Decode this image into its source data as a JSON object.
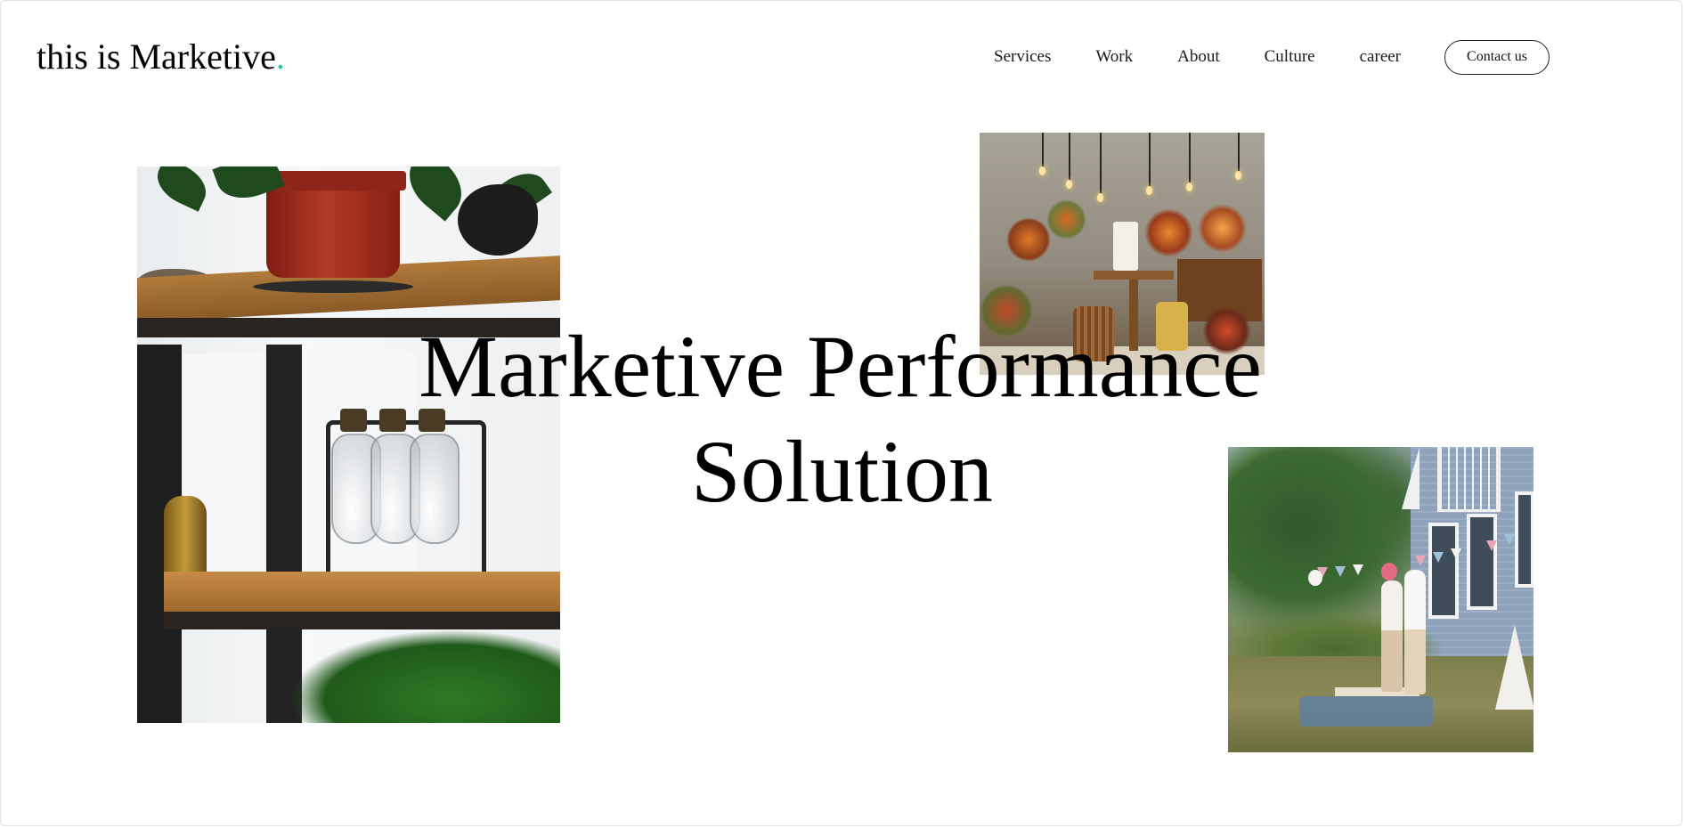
{
  "brand": {
    "logo_text": "this is Marketive",
    "logo_dot": ".",
    "accent_color": "#22c9a4"
  },
  "nav": {
    "items": [
      {
        "label": "Services"
      },
      {
        "label": "Work"
      },
      {
        "label": "About"
      },
      {
        "label": "Culture"
      },
      {
        "label": "career"
      }
    ],
    "contact_label": "Contact us"
  },
  "hero": {
    "title_line1": "Marketive Performance",
    "title_line2": "Solution"
  },
  "images": [
    {
      "subject": "shelf with plants and glass bottles"
    },
    {
      "subject": "decorated party dessert table with flowers"
    },
    {
      "subject": "couple at garden picnic beside house"
    }
  ]
}
